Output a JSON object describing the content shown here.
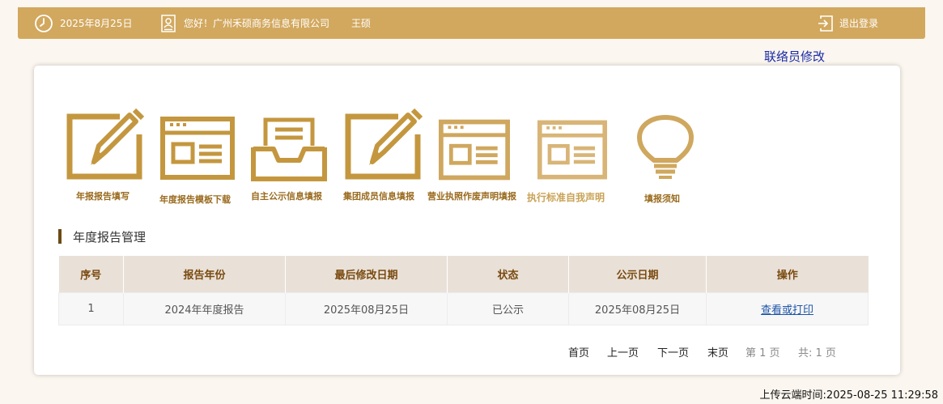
{
  "header": {
    "date": "2025年8月25日",
    "greeting": "您好！广州禾硕商务信息有限公司",
    "user_name": "王硕",
    "logout_label": "退出登录"
  },
  "liaison_link": "联络员修改",
  "tiles": [
    {
      "label": "年报报告填写",
      "icon": "pencil-edit-icon"
    },
    {
      "label": "年度报告模板下载",
      "icon": "document-panel-icon"
    },
    {
      "label": "自主公示信息填报",
      "icon": "inbox-tray-icon"
    },
    {
      "label": "集团成员信息填报",
      "icon": "pencil-edit-icon"
    },
    {
      "label": "营业执照作废声明填报",
      "icon": "document-panel-icon"
    },
    {
      "label": "执行标准自我声明",
      "icon": "document-panel-icon"
    },
    {
      "label": "填报须知",
      "icon": "lightbulb-icon"
    }
  ],
  "section_title": "年度报告管理",
  "table": {
    "columns": [
      "序号",
      "报告年份",
      "最后修改日期",
      "状态",
      "公示日期",
      "操作"
    ],
    "rows": [
      [
        "1",
        "2024年年度报告",
        "2025年08月25日",
        "已公示",
        "2025年08月25日",
        "查看或打印"
      ]
    ]
  },
  "pagination": {
    "first": "首页",
    "prev": "上一页",
    "next": "下一页",
    "last": "末页",
    "current": "第 1 页",
    "total": "共: 1 页"
  },
  "upload_time": "上传云端时间:2025-08-25 11:29:58",
  "colors": {
    "header_bg": "#d2a85e",
    "icon_gold": "#c4973f",
    "table_header_bg": "#e9e1d8",
    "link_blue": "#1e55a8"
  }
}
